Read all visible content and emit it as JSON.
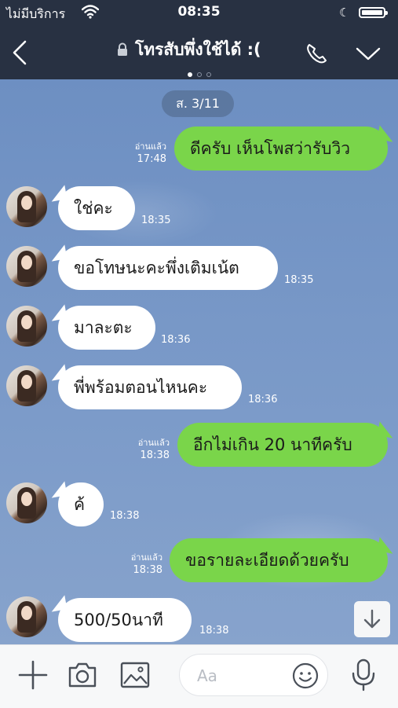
{
  "status_bar": {
    "carrier": "ไม่มีบริการ",
    "time": "08:35"
  },
  "header": {
    "title": "โทรสับพึ่งใช้ได้ :(",
    "page_dots": 3,
    "active_dot": 0
  },
  "chat": {
    "date_label": "ส. 3/11",
    "messages": [
      {
        "side": "out",
        "text": "ดีครับ เห็นโพสว่ารับวิว",
        "read": "อ่านแล้ว",
        "time": "17:48"
      },
      {
        "side": "in",
        "text": "ใช่คะ",
        "time": "18:35"
      },
      {
        "side": "in",
        "text": "ขอโทษนะคะพึ่งเติมเน้ต",
        "time": "18:35"
      },
      {
        "side": "in",
        "text": "มาละตะ",
        "time": "18:36"
      },
      {
        "side": "in",
        "text": "พี่พร้อมตอนไหนคะ",
        "time": "18:36"
      },
      {
        "side": "out",
        "text": "อีกไม่เกิน 20 นาทีครับ",
        "read": "อ่านแล้ว",
        "time": "18:38"
      },
      {
        "side": "in",
        "text": "ค้",
        "time": "18:38"
      },
      {
        "side": "out",
        "text": "ขอรายละเอียดด้วยครับ",
        "read": "อ่านแล้ว",
        "time": "18:38"
      },
      {
        "side": "in",
        "text": "500/50นาที",
        "time": "18:38"
      }
    ]
  },
  "input": {
    "placeholder": "Aa"
  },
  "colors": {
    "header_bg": "#283142",
    "outgoing_bubble": "#7ad54a",
    "incoming_bubble": "#ffffff",
    "chat_bg": "#7c9bc9"
  },
  "icons": [
    "wifi-icon",
    "moon-icon",
    "battery-icon",
    "back-icon",
    "lock-icon",
    "phone-icon",
    "chevron-down-icon",
    "scroll-down-icon",
    "plus-icon",
    "camera-icon",
    "image-icon",
    "emoji-icon",
    "microphone-icon"
  ]
}
